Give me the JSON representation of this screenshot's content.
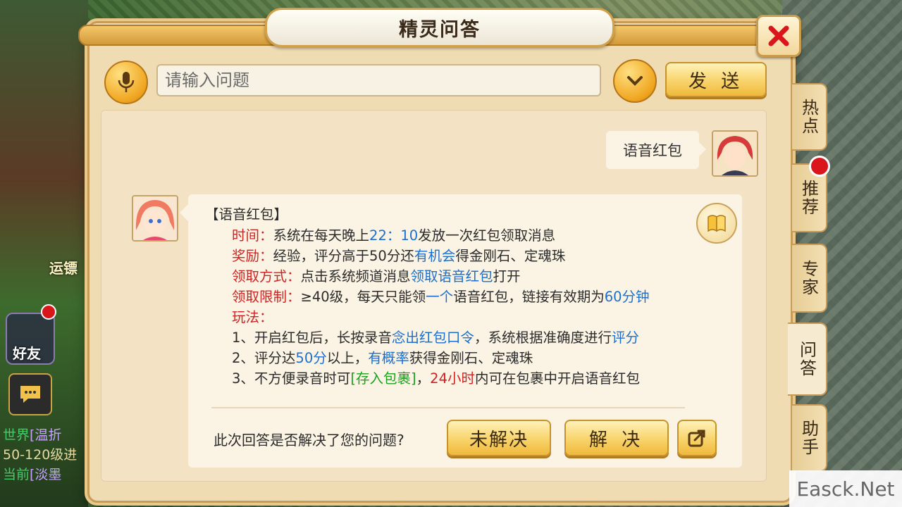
{
  "dialog": {
    "title": "精灵问答"
  },
  "input": {
    "placeholder": "请输入问题",
    "value": ""
  },
  "buttons": {
    "send": "发 送",
    "unsolved": "未解决",
    "solved": "解 决"
  },
  "side_tabs": [
    "热点",
    "推荐",
    "专家",
    "问答",
    "助手"
  ],
  "user_message": "语音红包",
  "answer": {
    "title": "【语音红包】",
    "time_label": "时间：",
    "time_pre": "系统在每天晚上",
    "time_value": "22：10",
    "time_post": "发放一次红包领取消息",
    "reward_label": "奖励：",
    "reward_pre": "经验，评分高于50分还",
    "reward_link": "有机会",
    "reward_post": "得金刚石、定魂珠",
    "method_label": "领取方式：",
    "method_pre": "点击系统频道消息",
    "method_link": "领取语音红包",
    "method_post": "打开",
    "limit_label": "领取限制：",
    "limit_pre": "≥40级，每天只能领",
    "limit_link": "一个",
    "limit_mid": "语音红包，链接有效期为",
    "limit_value": "60分钟",
    "play_label": "玩法：",
    "s1_pre": "1、开启红包后，长按录音",
    "s1_link": "念出红包口令",
    "s1_mid": "，系统根据准确度进行",
    "s1_link2": "评分",
    "s2_pre": "2、评分达",
    "s2_value": "50分",
    "s2_mid": "以上，",
    "s2_link": "有概率",
    "s2_post": "获得金刚石、定魂珠",
    "s3_pre": "3、不方便录音时可",
    "s3_green": "[存入包裹]",
    "s3_comma": "，",
    "s3_red": "24小时",
    "s3_post": "内可在包裹中开启语音红包"
  },
  "feedback": {
    "question": "此次回答是否解决了您的问题?"
  },
  "hud": {
    "yunbiao": "运镖",
    "haoyou": "好友",
    "chat_lines": [
      {
        "channel": "世界",
        "text": "[温折"
      },
      {
        "channel": "",
        "text": "50-120级进"
      },
      {
        "channel": "当前",
        "text": "[淡墨"
      }
    ]
  },
  "watermark": "Easck.Net",
  "colors": {
    "accent_gold": "#f0b93c",
    "link_blue": "#1b6fd0",
    "label_red": "#d02222",
    "store_green": "#18a31d"
  }
}
